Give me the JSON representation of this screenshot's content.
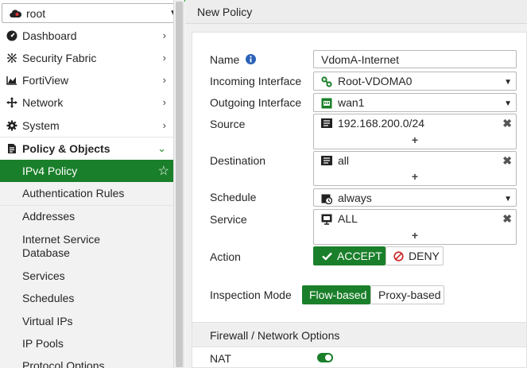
{
  "vdom": {
    "value": "root"
  },
  "nav": {
    "items": [
      {
        "label": "Dashboard",
        "icon": "dashboard-icon"
      },
      {
        "label": "Security Fabric",
        "icon": "security-fabric-icon"
      },
      {
        "label": "FortiView",
        "icon": "fortiview-icon"
      },
      {
        "label": "Network",
        "icon": "network-icon"
      },
      {
        "label": "System",
        "icon": "system-gear-icon"
      },
      {
        "label": "Policy & Objects",
        "icon": "policy-objects-icon"
      }
    ],
    "sub_items": [
      {
        "label": "IPv4 Policy",
        "active": true
      },
      {
        "label": "Authentication Rules"
      },
      {
        "label": "Addresses"
      },
      {
        "label": "Internet Service Database"
      },
      {
        "label": "Services"
      },
      {
        "label": "Schedules"
      },
      {
        "label": "Virtual IPs"
      },
      {
        "label": "IP Pools"
      },
      {
        "label": "Protocol Options"
      }
    ]
  },
  "page": {
    "title": "New Policy"
  },
  "form": {
    "name": {
      "label": "Name",
      "value": "VdomA-Internet"
    },
    "incoming": {
      "label": "Incoming Interface",
      "value": "Root-VDOMA0"
    },
    "outgoing": {
      "label": "Outgoing Interface",
      "value": "wan1"
    },
    "source": {
      "label": "Source",
      "value": "192.168.200.0/24",
      "add": "+"
    },
    "destination": {
      "label": "Destination",
      "value": "all",
      "add": "+"
    },
    "schedule": {
      "label": "Schedule",
      "value": "always"
    },
    "service": {
      "label": "Service",
      "value": "ALL",
      "add": "+"
    },
    "action": {
      "label": "Action",
      "accept": "ACCEPT",
      "deny": "DENY"
    },
    "inspection": {
      "label": "Inspection Mode",
      "flow": "Flow-based",
      "proxy": "Proxy-based"
    },
    "section_title": "Firewall / Network Options",
    "nat": {
      "label": "NAT",
      "enabled": true
    }
  },
  "colors": {
    "accent": "#1a7f2a",
    "deny": "#cc2222"
  }
}
